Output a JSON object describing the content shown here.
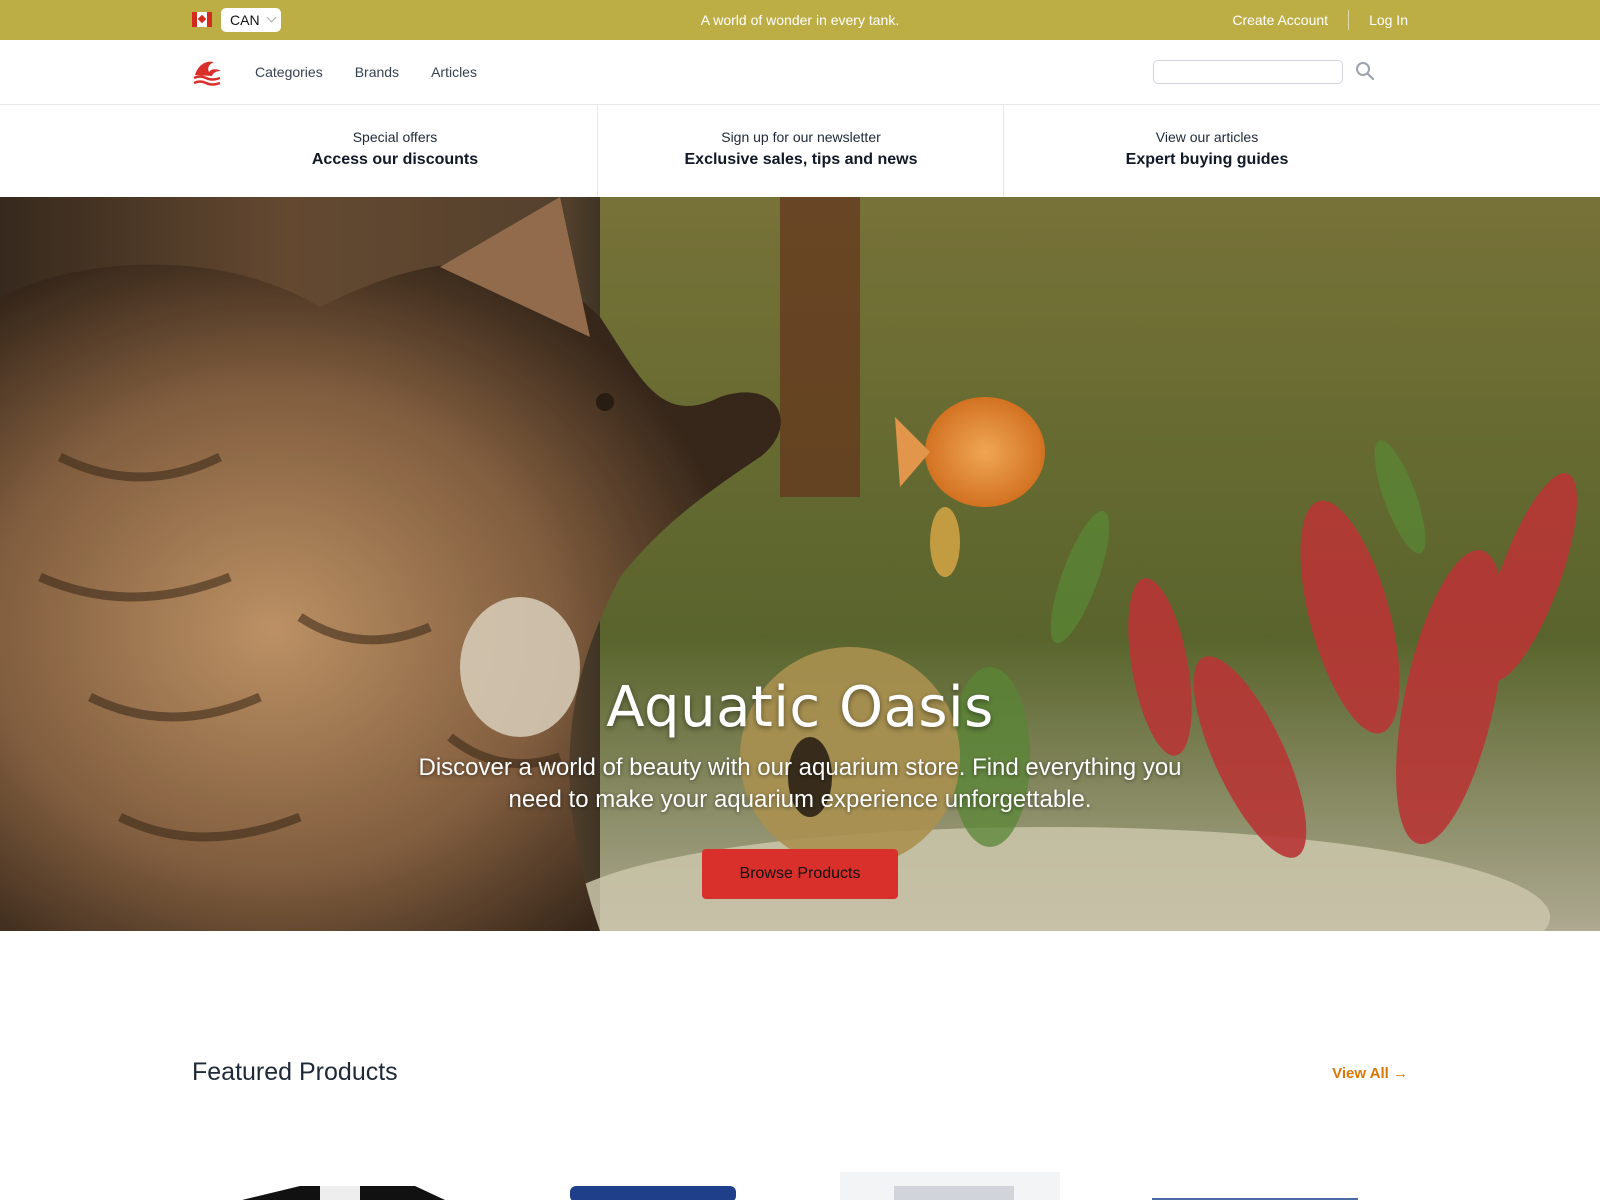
{
  "topbar": {
    "country_flag_icon": "canada-flag-icon",
    "country_code": "CAN",
    "tagline": "A world of wonder in every tank.",
    "create_account": "Create Account",
    "log_in": "Log In",
    "background_color": "#bcad45"
  },
  "nav": {
    "logo_icon": "wave-logo-icon",
    "links": [
      "Categories",
      "Brands",
      "Articles"
    ],
    "search": {
      "value": "",
      "placeholder": ""
    },
    "search_icon": "search-icon"
  },
  "promos": [
    {
      "small": "Special offers",
      "big": "Access our discounts"
    },
    {
      "small": "Sign up for our newsletter",
      "big": "Exclusive sales, tips and news"
    },
    {
      "small": "View our articles",
      "big": "Expert buying guides"
    }
  ],
  "hero": {
    "title": "Aquatic Oasis",
    "subtitle": "Discover a world of beauty with our aquarium store. Find everything you need to make your aquarium experience unforgettable.",
    "button": "Browse Products",
    "button_color": "#d9302c"
  },
  "featured": {
    "title": "Featured Products",
    "view_all": "View All →",
    "accent_color": "#d97706"
  }
}
